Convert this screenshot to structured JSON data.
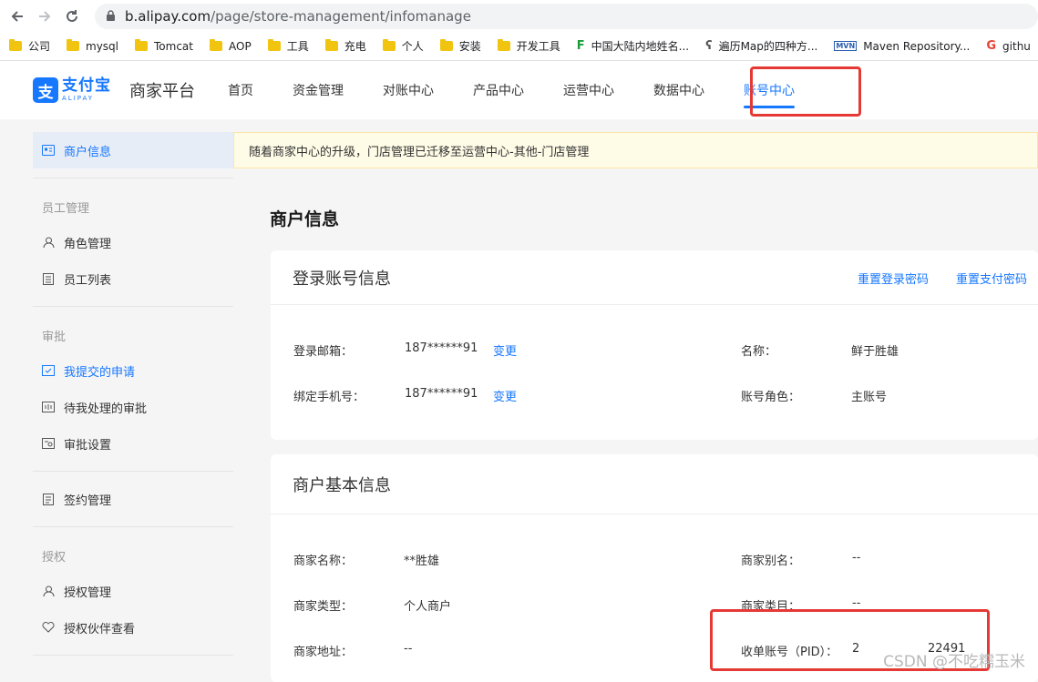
{
  "browser": {
    "url_host": "b.alipay.com",
    "url_path": "/page/store-management/infomanage",
    "bookmarks": [
      {
        "label": "公司",
        "kind": "folder"
      },
      {
        "label": "mysql",
        "kind": "folder"
      },
      {
        "label": "Tomcat",
        "kind": "folder"
      },
      {
        "label": "AOP",
        "kind": "folder"
      },
      {
        "label": "工具",
        "kind": "folder"
      },
      {
        "label": "充电",
        "kind": "folder"
      },
      {
        "label": "个人",
        "kind": "folder"
      },
      {
        "label": "安装",
        "kind": "folder"
      },
      {
        "label": "开发工具",
        "kind": "folder"
      },
      {
        "label": "中国大陆内地姓名...",
        "kind": "site-f"
      },
      {
        "label": "遍历Map的四种方...",
        "kind": "site-csdn"
      },
      {
        "label": "Maven Repository...",
        "kind": "site-mvn"
      },
      {
        "label": "githu",
        "kind": "site-g"
      }
    ]
  },
  "header": {
    "logo_cn": "支付宝",
    "logo_en": "ALIPAY",
    "logo_mark": "支",
    "platform": "商家平台",
    "menu": [
      "首页",
      "资金管理",
      "对账中心",
      "产品中心",
      "运营中心",
      "数据中心",
      "账号中心"
    ],
    "active_menu": "账号中心"
  },
  "sidebar": {
    "top_item": "商户信息",
    "group_staff": "员工管理",
    "item_roles": "角色管理",
    "item_staff_list": "员工列表",
    "group_approval": "审批",
    "item_my_requests": "我提交的申请",
    "item_pending": "待我处理的审批",
    "item_approval_settings": "审批设置",
    "item_contracts": "签约管理",
    "group_auth": "授权",
    "item_auth_manage": "授权管理",
    "item_partners": "授权伙伴查看"
  },
  "notice": "随着商家中心的升级，门店管理已迁移至运营中心-其他-门店管理",
  "page_title": "商户信息",
  "login_card": {
    "title": "登录账号信息",
    "link_reset_login": "重置登录密码",
    "link_reset_pay": "重置支付密码",
    "email_label": "登录邮箱：",
    "email_value": "187******91",
    "email_change": "变更",
    "phone_label": "绑定手机号：",
    "phone_value": "187******91",
    "phone_change": "变更",
    "name_label": "名称：",
    "name_value": "鲜于胜雄",
    "role_label": "账号角色：",
    "role_value": "主账号"
  },
  "basic_card": {
    "title": "商户基本信息",
    "merchant_name_label": "商家名称：",
    "merchant_name_value": "**胜雄",
    "merchant_type_label": "商家类型：",
    "merchant_type_value": "个人商户",
    "address_label": "商家地址：",
    "address_value": "--",
    "alias_label": "商家别名：",
    "alias_value": "--",
    "category_label": "商家类目：",
    "category_value": "--",
    "pid_label": "收单账号（PID）：",
    "pid_value_start": "2",
    "pid_value_end": "22491"
  },
  "watermark": "CSDN @不吃糯玉米",
  "colors": {
    "accent": "#1677ff",
    "highlight_box": "#e53935",
    "notice_bg": "#fefbe6"
  }
}
